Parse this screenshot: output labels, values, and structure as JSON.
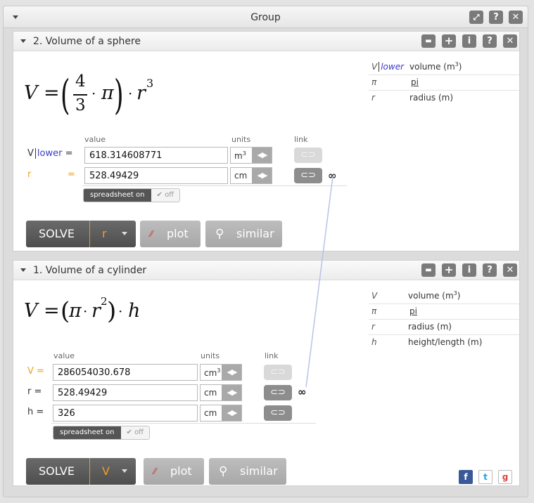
{
  "window": {
    "title": "Group"
  },
  "sphere": {
    "title": "2. Volume of a sphere",
    "equation": {
      "lhs": "V",
      "num": "4",
      "den": "3",
      "pi": "π",
      "r": "r",
      "exp": "3"
    },
    "table": [
      {
        "sym": "V",
        "sym2": "lower",
        "desc": "volume (m",
        "sup": "3",
        "desc_end": ")"
      },
      {
        "sym": "π",
        "desc": "pi"
      },
      {
        "sym": "r",
        "desc": "radius (m)"
      }
    ],
    "headers": {
      "value": "value",
      "units": "units",
      "link": "link"
    },
    "rows": [
      {
        "label": "V",
        "label2": "lower",
        "eq": "=",
        "value": "618.314608771",
        "unit": "m",
        "unit_sup": "3"
      },
      {
        "label": "r",
        "eq": "=",
        "value": "528.49429",
        "unit": "cm"
      }
    ],
    "spreadsheet": {
      "on": "spreadsheet on",
      "off": "off"
    },
    "solve": {
      "label": "SOLVE",
      "var": "r"
    },
    "plot": "plot",
    "similar": "similar"
  },
  "cylinder": {
    "title": "1. Volume of a cylinder",
    "equation": {
      "lhs": "V",
      "pi": "π",
      "r": "r",
      "exp": "2",
      "h": "h"
    },
    "table": [
      {
        "sym": "V",
        "desc": "volume (m",
        "sup": "3",
        "desc_end": ")"
      },
      {
        "sym": "π",
        "desc": "pi"
      },
      {
        "sym": "r",
        "desc": "radius (m)"
      },
      {
        "sym": "h",
        "desc": "height/length (m)"
      }
    ],
    "headers": {
      "value": "value",
      "units": "units",
      "link": "link"
    },
    "rows": [
      {
        "label": "V =",
        "value": "286054030.678",
        "unit": "cm",
        "unit_sup": "3"
      },
      {
        "label": "r =",
        "value": "528.49429",
        "unit": "cm"
      },
      {
        "label": "h =",
        "value": "326",
        "unit": "cm"
      }
    ],
    "spreadsheet": {
      "on": "spreadsheet on",
      "off": "off"
    },
    "solve": {
      "label": "SOLVE",
      "var": "V"
    },
    "plot": "plot",
    "similar": "similar"
  },
  "colors": {
    "accent": "#f0a020",
    "link_line": "#b8c4e6",
    "lower": "#3a3ac8"
  },
  "social": [
    "f",
    "t",
    "g"
  ]
}
